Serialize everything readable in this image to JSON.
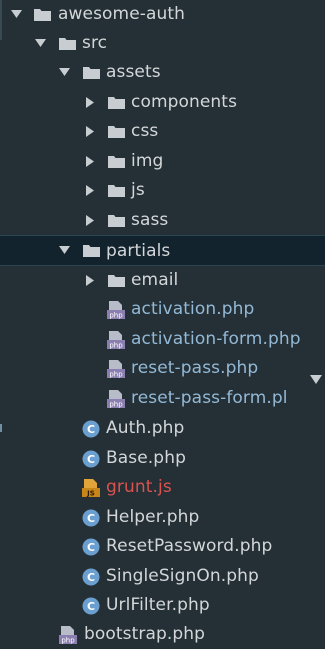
{
  "tree": {
    "root": {
      "label": "awesome-auth",
      "icon": "folder-icon",
      "expanded": true
    },
    "items": [
      {
        "id": "src",
        "label": "src",
        "type": "folder",
        "expanded": true
      },
      {
        "id": "assets",
        "label": "assets",
        "type": "folder",
        "expanded": true
      },
      {
        "id": "components",
        "label": "components",
        "type": "folder",
        "expanded": false
      },
      {
        "id": "css",
        "label": "css",
        "type": "folder",
        "expanded": false
      },
      {
        "id": "img",
        "label": "img",
        "type": "folder",
        "expanded": false
      },
      {
        "id": "js",
        "label": "js",
        "type": "folder",
        "expanded": false
      },
      {
        "id": "sass",
        "label": "sass",
        "type": "folder",
        "expanded": false
      },
      {
        "id": "partials",
        "label": "partials",
        "type": "folder",
        "expanded": true,
        "selected": true
      },
      {
        "id": "email",
        "label": "email",
        "type": "folder",
        "expanded": false
      },
      {
        "id": "activation",
        "label": "activation.php",
        "type": "php-file"
      },
      {
        "id": "activation-form",
        "label": "activation-form.php",
        "type": "php-file"
      },
      {
        "id": "reset-pass",
        "label": "reset-pass.php",
        "type": "php-file"
      },
      {
        "id": "reset-pass-form",
        "label": "reset-pass-form.pl",
        "type": "php-file"
      },
      {
        "id": "auth",
        "label": "Auth.php",
        "type": "php-class"
      },
      {
        "id": "base",
        "label": "Base.php",
        "type": "php-class"
      },
      {
        "id": "grunt",
        "label": "grunt.js",
        "type": "js-file"
      },
      {
        "id": "helper",
        "label": "Helper.php",
        "type": "php-class"
      },
      {
        "id": "resetpassword",
        "label": "ResetPassword.php",
        "type": "php-class"
      },
      {
        "id": "singlesignon",
        "label": "SingleSignOn.php",
        "type": "php-class"
      },
      {
        "id": "urlfilter",
        "label": "UrlFilter.php",
        "type": "php-class"
      },
      {
        "id": "bootstrap",
        "label": "bootstrap.php",
        "type": "php-file"
      }
    ],
    "php_badge": "php",
    "js_badge": "JS",
    "class_badge": "C"
  },
  "colors": {
    "background": "#243036",
    "selected_row": "#13232e",
    "text": "#d4d7d9",
    "js_file_text": "#d9534f",
    "php_class_icon": "#6a9fd0",
    "folder_icon": "#c7cdd1",
    "php_icon": "#8a7fb0",
    "js_icon": "#e0a43a"
  }
}
